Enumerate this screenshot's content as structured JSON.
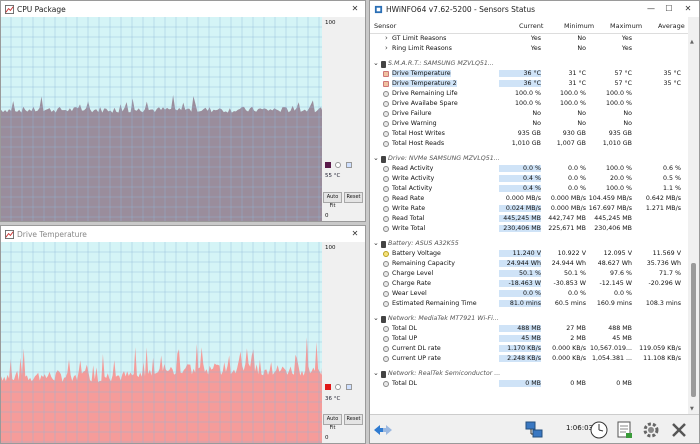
{
  "cpu_window": {
    "title": "CPU Package",
    "scale_top": "100",
    "scale_bottom": "0",
    "current_value": "55 °C",
    "auto_fit_label": "Auto Fit",
    "reset_label": "Reset",
    "fill_color": "#9a8d9c",
    "bg_color": "#d4f4f6"
  },
  "drive_window": {
    "title": "Drive Temperature",
    "scale_top": "100",
    "scale_bottom": "0",
    "current_value": "36 °C",
    "auto_fit_label": "Auto Fit",
    "reset_label": "Reset",
    "fill_color": "#f59c9a",
    "bg_color": "#d4f4f6"
  },
  "sensor_window": {
    "title": "HWiNFO64 v7.62-5200 - Sensors Status",
    "columns": {
      "sensor": "Sensor",
      "current": "Current",
      "minimum": "Minimum",
      "maximum": "Maximum",
      "average": "Average"
    },
    "groups": [
      {
        "title": "",
        "rows": [
          {
            "name": "GT Limit Reasons",
            "type": "expand",
            "cur": "Yes",
            "min": "No",
            "max": "Yes",
            "avg": ""
          },
          {
            "name": "Ring Limit Reasons",
            "type": "expand",
            "cur": "Yes",
            "min": "No",
            "max": "Yes",
            "avg": ""
          }
        ]
      },
      {
        "title": "S.M.A.R.T.: SAMSUNG MZVLQ51...",
        "rows": [
          {
            "name": "Drive Temperature",
            "type": "temp",
            "cur": "36 °C",
            "min": "31 °C",
            "max": "57 °C",
            "avg": "35 °C",
            "selected": true
          },
          {
            "name": "Drive Temperature 2",
            "type": "temp",
            "cur": "36 °C",
            "min": "31 °C",
            "max": "57 °C",
            "avg": "35 °C",
            "selected": true
          },
          {
            "name": "Drive Remaining Life",
            "type": "gen",
            "cur": "100.0 %",
            "min": "100.0 %",
            "max": "100.0 %",
            "avg": ""
          },
          {
            "name": "Drive Availabe Spare",
            "type": "gen",
            "cur": "100.0 %",
            "min": "100.0 %",
            "max": "100.0 %",
            "avg": ""
          },
          {
            "name": "Drive Failure",
            "type": "gen",
            "cur": "No",
            "min": "No",
            "max": "No",
            "avg": ""
          },
          {
            "name": "Drive Warning",
            "type": "gen",
            "cur": "No",
            "min": "No",
            "max": "No",
            "avg": ""
          },
          {
            "name": "Total Host Writes",
            "type": "gen",
            "cur": "935 GB",
            "min": "930 GB",
            "max": "935 GB",
            "avg": ""
          },
          {
            "name": "Total Host Reads",
            "type": "gen",
            "cur": "1,010 GB",
            "min": "1,007 GB",
            "max": "1,010 GB",
            "avg": ""
          }
        ]
      },
      {
        "title": "Drive: NVMe SAMSUNG MZVLQ51...",
        "rows": [
          {
            "name": "Read Activity",
            "type": "gen",
            "cur": "0.0 %",
            "min": "0.0 %",
            "max": "100.0 %",
            "avg": "0.6 %"
          },
          {
            "name": "Write Activity",
            "type": "gen",
            "cur": "0.4 %",
            "min": "0.0 %",
            "max": "20.0 %",
            "avg": "0.5 %"
          },
          {
            "name": "Total Activity",
            "type": "gen",
            "cur": "0.4 %",
            "min": "0.0 %",
            "max": "100.0 %",
            "avg": "1.1 %"
          },
          {
            "name": "Read Rate",
            "type": "gen",
            "cur": "0.000 MB/s",
            "min": "0.000 MB/s",
            "max": "104.459 MB/s",
            "avg": "0.642 MB/s"
          },
          {
            "name": "Write Rate",
            "type": "gen",
            "cur": "0.024 MB/s",
            "min": "0.000 MB/s",
            "max": "167.697 MB/s",
            "avg": "1.271 MB/s"
          },
          {
            "name": "Read Total",
            "type": "gen",
            "cur": "445,245 MB",
            "min": "442,747 MB",
            "max": "445,245 MB",
            "avg": ""
          },
          {
            "name": "Write Total",
            "type": "gen",
            "cur": "230,406 MB",
            "min": "225,671 MB",
            "max": "230,406 MB",
            "avg": ""
          }
        ]
      },
      {
        "title": "Battery: ASUS  A32K55",
        "rows": [
          {
            "name": "Battery Voltage",
            "type": "volt",
            "cur": "11.240 V",
            "min": "10.922 V",
            "max": "12.095 V",
            "avg": "11.569 V"
          },
          {
            "name": "Remaining Capacity",
            "type": "gen",
            "cur": "24.944 Wh",
            "min": "24.944 Wh",
            "max": "48.627 Wh",
            "avg": "35.736 Wh"
          },
          {
            "name": "Charge Level",
            "type": "gen",
            "cur": "50.1 %",
            "min": "50.1 %",
            "max": "97.6 %",
            "avg": "71.7 %"
          },
          {
            "name": "Charge Rate",
            "type": "gen",
            "cur": "-18.463 W",
            "min": "-30.853 W",
            "max": "-12.145 W",
            "avg": "-20.296 W"
          },
          {
            "name": "Wear Level",
            "type": "gen",
            "cur": "0.0 %",
            "min": "0.0 %",
            "max": "0.0 %",
            "avg": ""
          },
          {
            "name": "Estimated Remaining Time",
            "type": "gen",
            "cur": "81.0 mins",
            "min": "60.5 mins",
            "max": "160.9 mins",
            "avg": "108.3 mins"
          }
        ]
      },
      {
        "title": "Network: MediaTek MT7921 Wi-Fi...",
        "rows": [
          {
            "name": "Total DL",
            "type": "gen",
            "cur": "488 MB",
            "min": "27 MB",
            "max": "488 MB",
            "avg": ""
          },
          {
            "name": "Total UP",
            "type": "gen",
            "cur": "45 MB",
            "min": "2 MB",
            "max": "45 MB",
            "avg": ""
          },
          {
            "name": "Current DL rate",
            "type": "gen",
            "cur": "1.170 KB/s",
            "min": "0.000 KB/s",
            "max": "10,567.019...",
            "avg": "119.059 KB/s"
          },
          {
            "name": "Current UP rate",
            "type": "gen",
            "cur": "2.248 KB/s",
            "min": "0.000 KB/s",
            "max": "1,054.381 ...",
            "avg": "11.108 KB/s"
          }
        ]
      },
      {
        "title": "Network: RealTek Semiconductor ...",
        "rows": [
          {
            "name": "Total DL",
            "type": "gen",
            "cur": "0 MB",
            "min": "0 MB",
            "max": "0 MB",
            "avg": ""
          }
        ]
      }
    ],
    "footer": {
      "elapsed_time": "1:06:03"
    }
  }
}
